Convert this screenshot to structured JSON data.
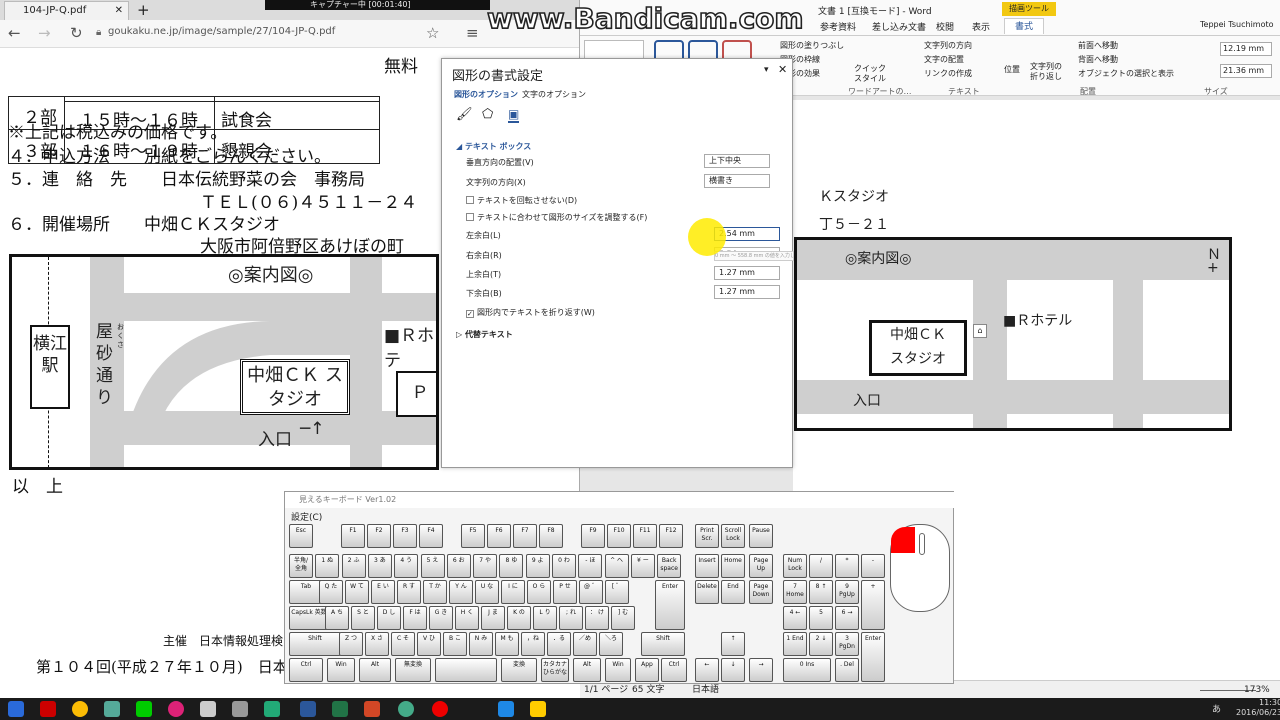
{
  "recorder": {
    "brand": "www.Bandicam.com",
    "status": "キャプチャー中 [00:01:40]"
  },
  "browser": {
    "tab_title": "104-JP-Q.pdf",
    "url": "goukaku.ne.jp/image/sample/27/104-JP-Q.pdf",
    "doc": {
      "rows": [
        {
          "part": "２部",
          "time": "１５時～１６時",
          "event": "試食会"
        },
        {
          "part": "３部",
          "time": "１６時～１９時",
          "event": "懇親会"
        }
      ],
      "fee": "無料",
      "line_tax": "※上記は税込みの価格です。",
      "line_apply": "４．申込方法　　別紙をごらんください。",
      "line_contact": "５．連　絡　先　　日本伝統野菜の会　事務局",
      "line_tel": "ＴＥＬ(０６)４５１１－２４",
      "line_venue": "６．開催場所　　中畑ＣＫスタジオ",
      "line_address": "大阪市阿倍野区あけぼの町",
      "map_title": "◎案内図◎",
      "station": "横江駅",
      "street": "屋砂通り",
      "street_ruby": "おくさ",
      "studio": "中畑ＣＫ スタジオ",
      "hotel": "■Ｒホテ",
      "parking": "Ｐ",
      "entrance": "入口",
      "end": "以　上",
      "footer_org": "主催　日本情報処理検",
      "footer_exam": "第１０４回(平成２７年１０月)　日本"
    }
  },
  "word": {
    "title": "文書 1 [互換モード] - Word",
    "tool_tab": "描画ツール",
    "tabs": [
      "参考資料",
      "差し込み文書",
      "校閲",
      "表示",
      "書式"
    ],
    "user": "Teppei Tsuchimoto",
    "ribbon": {
      "fill": "図形の塗りつぶし",
      "outline": "図形の枠線",
      "effects": "図形の効果",
      "quick_style": "クイック スタイル",
      "wordart": "ワードアートの…",
      "text_dir": "文字列の方向",
      "text_align": "文字の配置",
      "link": "リンクの作成",
      "text_group": "テキスト",
      "position": "位置",
      "wrap": "文字列の折り返し",
      "forward": "前面へ移動",
      "backward": "背面へ移動",
      "select_pane": "オブジェクトの選択と表示",
      "arrange_group": "配置",
      "height": "12.19 mm",
      "width": "21.36 mm",
      "size_group": "サイズ"
    },
    "page": {
      "studio_line": "Ｋスタジオ",
      "address_line": "丁５－２１",
      "map_title": "◎案内図◎",
      "north": "Ｎ",
      "hotel": "■Ｒホテル",
      "entrance": "入口",
      "textbox": "中畑ＣＫ",
      "textbox2": "スタジオ"
    },
    "status": {
      "page": "1/1 ページ",
      "words": "65 文字",
      "lang": "日本語",
      "zoom": "173%"
    }
  },
  "panel": {
    "title": "図形の書式設定",
    "tab_shape": "図形のオプション",
    "tab_text": "文字のオプション",
    "section": "テキスト ボックス",
    "valign_label": "垂直方向の配置(V)",
    "valign_value": "上下中央",
    "dir_label": "文字列の方向(X)",
    "dir_value": "横書き",
    "chk_norotate": "テキストを回転させない(D)",
    "chk_resize": "テキストに合わせて図形のサイズを調整する(F)",
    "left_label": "左余白(L)",
    "left_value": "2.54 mm",
    "right_label": "右余白(R)",
    "right_value": "2.54 mm",
    "top_label": "上余白(T)",
    "top_value": "1.27 mm",
    "bottom_label": "下余白(B)",
    "bottom_value": "1.27 mm",
    "chk_wrap": "図形内でテキストを折り返す(W)",
    "alt_text": "代替テキスト",
    "tooltip": "0 mm ～ 558.8 mm の値を入力してくだ"
  },
  "keyboard": {
    "title": "見えるキーボード Ver1.02",
    "menu": "設定(C)",
    "fn": [
      "Esc",
      "F1",
      "F2",
      "F3",
      "F4",
      "F5",
      "F6",
      "F7",
      "F8",
      "F9",
      "F10",
      "F11",
      "F12",
      "Print Scr.",
      "Scroll Lock",
      "Pause"
    ],
    "row1": [
      "半角/全角",
      "1 ぬ",
      "2 ふ",
      "3 あ",
      "4 う",
      "5 え",
      "6 お",
      "7 や",
      "8 ゆ",
      "9 よ",
      "0 わ",
      "- ほ",
      "^ へ",
      "¥ ー",
      "Back space"
    ],
    "row2": [
      "Tab",
      "Q た",
      "W て",
      "E い",
      "R す",
      "T か",
      "Y ん",
      "U な",
      "I に",
      "O ら",
      "P せ",
      "@ ゛",
      "[ ゜",
      "Enter"
    ],
    "row3": [
      "CapsLk 英数",
      "A ち",
      "S と",
      "D し",
      "F は",
      "G き",
      "H く",
      "J ま",
      "K の",
      "L り",
      "; れ",
      "： け",
      "] む"
    ],
    "row4": [
      "Shift",
      "Z つ",
      "X さ",
      "C そ",
      "V ひ",
      "B こ",
      "N み",
      "M も",
      "，ね",
      "．る",
      "／め",
      "＼ろ",
      "Shift"
    ],
    "row5": [
      "Ctrl",
      "Win",
      "Alt",
      "無変換",
      "",
      "変換",
      "カタカナ ひらがな",
      "Alt",
      "Win",
      "App",
      "Ctrl"
    ],
    "nav": [
      "Insert",
      "Home",
      "Page Up",
      "Delete",
      "End",
      "Page Down",
      "↑",
      "←",
      "↓",
      "→"
    ],
    "numpad": [
      "Num Lock",
      "/",
      "*",
      "-",
      "7 Home",
      "8 ↑",
      "9 PgUp",
      "+",
      "4 ←",
      "5",
      "6 →",
      "1 End",
      "2 ↓",
      "3 PgDn",
      "Enter",
      "0 Ins",
      ". Del"
    ]
  },
  "taskbar": {
    "time": "11:30",
    "date": "2016/06/23",
    "ime": "あ"
  },
  "colors": {
    "accent_word": "#2b579a",
    "tool_tab": "#f2c811",
    "mouse_button": "#ff0000",
    "cursor": "#ffeb00"
  }
}
